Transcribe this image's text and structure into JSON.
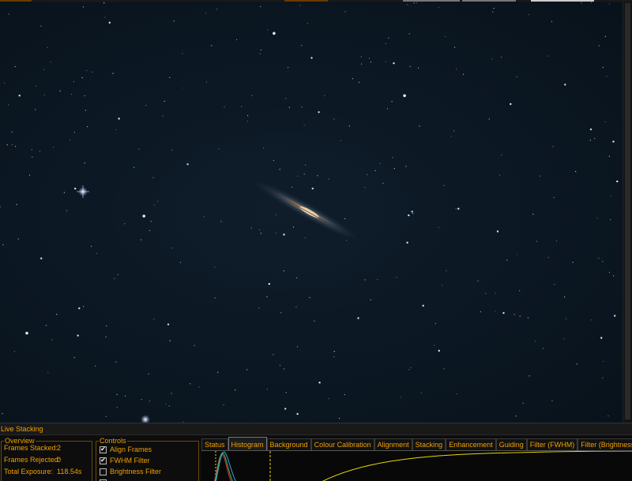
{
  "panel": {
    "title": "Live Stacking",
    "overview": {
      "legend": "Overview",
      "rows": [
        {
          "label": "Frames Stacked:",
          "value": "2"
        },
        {
          "label": "Frames Rejected:",
          "value": "0"
        },
        {
          "label": "Total Exposure:",
          "value": "118.54s"
        }
      ]
    },
    "controls": {
      "legend": "Controls",
      "items": [
        {
          "label": "Align Frames",
          "checked": true
        },
        {
          "label": "FWHM Filter",
          "checked": true
        },
        {
          "label": "Brightness Filter",
          "checked": false
        }
      ]
    },
    "tabs": [
      {
        "label": "Status",
        "active": false
      },
      {
        "label": "Histogram",
        "active": true
      },
      {
        "label": "Background",
        "active": false
      },
      {
        "label": "Colour Calibration",
        "active": false
      },
      {
        "label": "Alignment",
        "active": false
      },
      {
        "label": "Stacking",
        "active": false
      },
      {
        "label": "Enhancement",
        "active": false
      },
      {
        "label": "Guiding",
        "active": false
      },
      {
        "label": "Filter (FWHM)",
        "active": false
      },
      {
        "label": "Filter (Brightness)",
        "active": false
      }
    ]
  },
  "colors": {
    "accent": "#f0a000",
    "sky": "#0b1722",
    "curve": "#e8d800",
    "hist_red": "#e03030",
    "hist_green": "#30c060",
    "hist_blue": "#40a0e0"
  }
}
